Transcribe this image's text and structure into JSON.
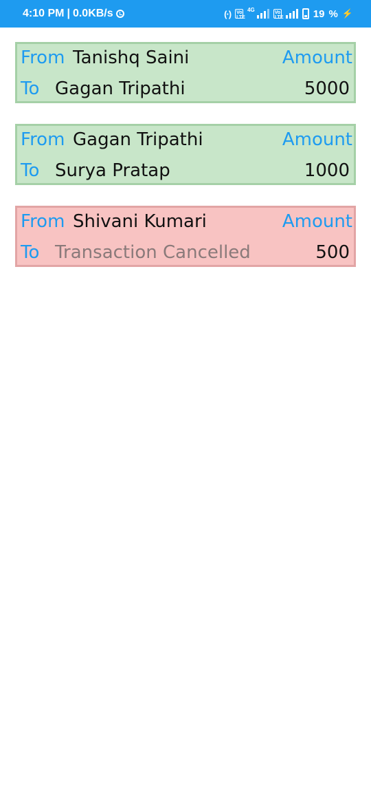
{
  "status_bar": {
    "time": "4:10 PM",
    "separator": "|",
    "speed": "0.0KB/s",
    "network_type": "4G",
    "volte_label": "Vo LTE",
    "battery_percent": "19",
    "percent_sign": "%"
  },
  "labels": {
    "from": "From",
    "to": "To",
    "amount": "Amount"
  },
  "colors": {
    "accent": "#1e9bf0",
    "success_bg": "#c8e6c9",
    "cancelled_bg": "#f8c3c2"
  },
  "transactions": [
    {
      "status": "success",
      "from": "Tanishq Saini",
      "to": "Gagan Tripathi",
      "amount": "5000"
    },
    {
      "status": "success",
      "from": "Gagan Tripathi",
      "to": "Surya Pratap",
      "amount": "1000"
    },
    {
      "status": "cancelled",
      "from": "Shivani Kumari",
      "to": "Transaction Cancelled",
      "amount": "500"
    }
  ]
}
